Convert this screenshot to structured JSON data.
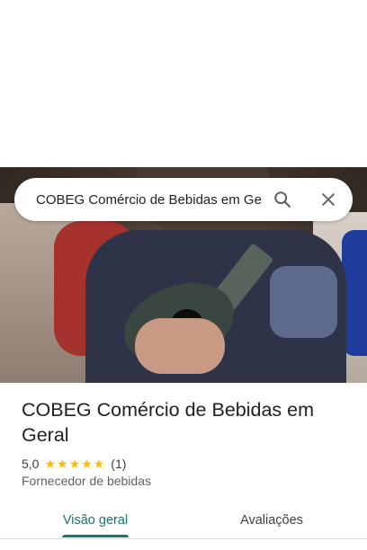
{
  "search": {
    "value": "COBEG Comércio de Bebidas em Ge",
    "search_icon": "search-icon",
    "close_icon": "close-icon"
  },
  "place": {
    "title": "COBEG Comércio de Bebidas em Geral",
    "rating": "5,0",
    "stars": 5,
    "review_count": "(1)",
    "category": "Fornecedor de bebidas"
  },
  "tabs": [
    {
      "label": "Visão geral",
      "active": true
    },
    {
      "label": "Avaliações",
      "active": false
    }
  ],
  "colors": {
    "accent": "#1a7569",
    "star": "#fbbc04",
    "title_text": "#202124",
    "secondary_text": "#5f6368"
  }
}
